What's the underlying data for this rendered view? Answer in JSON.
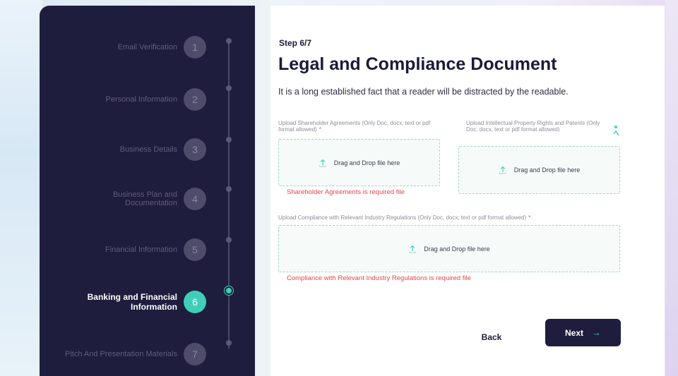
{
  "sidebar": {
    "steps": [
      {
        "label": "Email Verification",
        "number": "1"
      },
      {
        "label": "Personal Information",
        "number": "2"
      },
      {
        "label": "Business Details",
        "number": "3"
      },
      {
        "label": "Business Plan and Documentation",
        "number": "4"
      },
      {
        "label": "Financial Information",
        "number": "5"
      },
      {
        "label": "Banking and Financial Information",
        "number": "6"
      },
      {
        "label": "Pitch And Presentation Materials",
        "number": "7"
      }
    ],
    "active_step": 6
  },
  "main": {
    "step_indicator": "Step 6/7",
    "title": "Legal and Compliance Document",
    "subtitle": "It is a long established fact that a reader will be distracted by the readable.",
    "uploads": [
      {
        "label": "Upload Shareholder Agreements (Only Doc, docx, text or pdf format allowed)",
        "required_marker": "*",
        "dropzone_text": "Drag and Drop file here",
        "error": "Shareholder Agreements is required file"
      },
      {
        "label": "Upload Intellectual Property Rights and Patents (Only Doc, docx, text or pdf format allowed)",
        "required_marker": "",
        "dropzone_text": "Drag and Drop file here",
        "error": ""
      },
      {
        "label": "Upload Compliance with Relevant Industry Regulations (Only Doc, docx, text or pdf format allowed)",
        "required_marker": "*",
        "dropzone_text": "Drag and Drop file here",
        "error": "Compliance with Relevant Industry Regulations is required file"
      }
    ],
    "back_label": "Back",
    "next_label": "Next",
    "next_arrow": "→"
  },
  "colors": {
    "sidebar_bg": "#1f1d3d",
    "accent": "#3fcfb8",
    "error": "#e6454b",
    "dropzone_border": "#9ed9c6"
  },
  "icons": {
    "upload": "upload-icon",
    "arrow": "arrow-right-icon",
    "person": "person-icon"
  }
}
